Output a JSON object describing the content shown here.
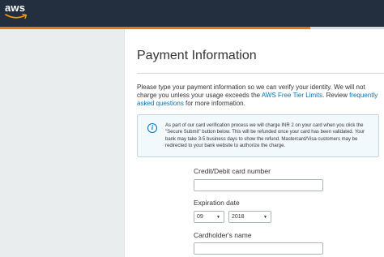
{
  "brand": {
    "logo_text": "aws"
  },
  "colors": {
    "header_bg": "#232f3e",
    "accent": "#e27624",
    "link": "#0073bb",
    "info_bg": "#f1f9fc"
  },
  "page": {
    "title": "Payment Information",
    "intro": {
      "part1": "Please type your payment information so we can verify your identity. We will not charge you unless your usage exceeds the ",
      "link1": "AWS Free Tier Limits",
      "part2": ". Review ",
      "link2": "frequently asked questions",
      "part3": " for more information."
    },
    "info": {
      "icon": "info-icon",
      "text": "As part of our card verification process we will charge INR 2 on your card when you click the \"Secure Submit\" button below. This will be refunded once your card has been validated. Your bank may take 3-5 business days to show the refund. Mastercard/Visa customers may be redirected to your bank website to authorize the charge."
    }
  },
  "form": {
    "card_number_label": "Credit/Debit card number",
    "card_number_value": "",
    "expiration_label": "Expiration date",
    "exp_month": "09",
    "exp_year": "2018",
    "cardholder_label": "Cardholder's name",
    "cardholder_value": ""
  }
}
